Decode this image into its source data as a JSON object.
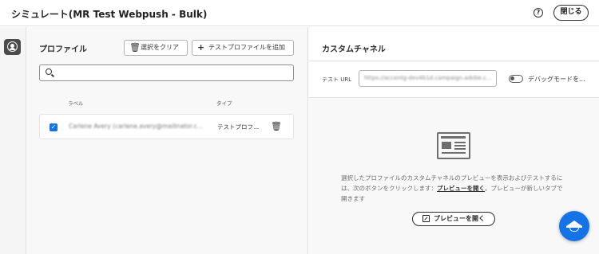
{
  "header": {
    "title": "シミュレート(MR Test Webpush - Bulk)",
    "help_icon": "help-circle-icon",
    "close_label": "閉じる"
  },
  "rail": {
    "items": [
      {
        "icon": "user-circle-icon",
        "active": true
      }
    ]
  },
  "profiles": {
    "title": "プロファイル",
    "clear_selection_label": "選択をクリア",
    "add_test_profile_label": "テストプロファイルを追加",
    "search_placeholder": "",
    "columns": {
      "label": "ラベル",
      "type": "タイプ"
    },
    "rows": [
      {
        "checked": true,
        "label": "Carlene Avery (carlene.avery@mailinator.c...",
        "type": "テストプロフ..."
      }
    ]
  },
  "channel": {
    "title": "カスタムチャネル",
    "test_url_label": "テスト URL",
    "test_url_value": "https://accentg-dev4b1d.campaign.adobe.c...",
    "debug_mode_label": "デバッグモードを...",
    "debug_mode_on": false,
    "description_before": "選択したプロファイルのカスタムチャネルのプレビューを表示およびテストするには、次のボタンをクリックします：",
    "description_link": "プレビューを開く",
    "description_after": "。プレビューが新しいタブで開きます",
    "open_preview_label": "プレビューを開く"
  },
  "fab": {
    "icon": "graduation-cap-icon"
  },
  "colors": {
    "accent": "#1473e6",
    "rail_active": "#4b4b4b"
  }
}
